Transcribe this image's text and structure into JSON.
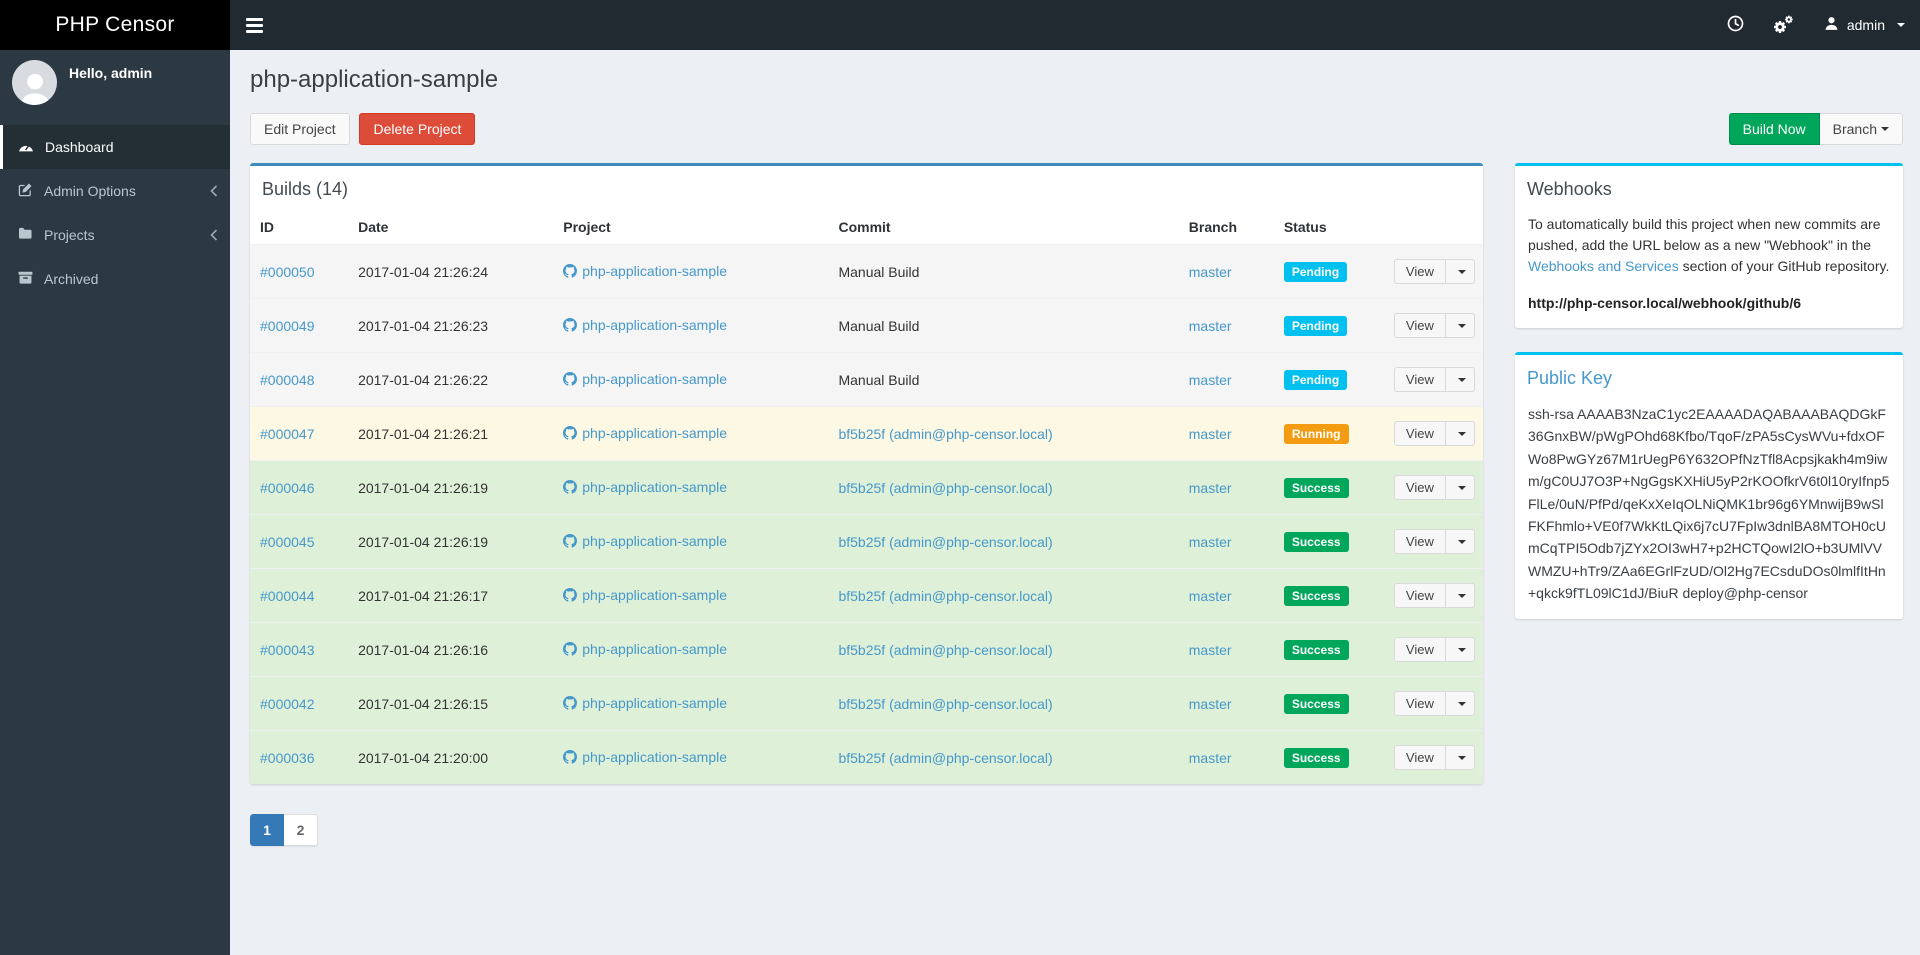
{
  "app": {
    "brand": "PHP Censor"
  },
  "navbar": {
    "user": "admin",
    "icons": [
      "clock-icon",
      "cogs-icon",
      "user-icon",
      "caret-down-icon"
    ]
  },
  "sidebar": {
    "greeting": "Hello, admin",
    "items": [
      {
        "label": "Dashboard",
        "icon": "dashboard-icon",
        "active": true,
        "has_chevron": false
      },
      {
        "label": "Admin Options",
        "icon": "edit-icon",
        "active": false,
        "has_chevron": true
      },
      {
        "label": "Projects",
        "icon": "folder-icon",
        "active": false,
        "has_chevron": true
      },
      {
        "label": "Archived",
        "icon": "archive-icon",
        "active": false,
        "has_chevron": false
      }
    ]
  },
  "page": {
    "title": "php-application-sample",
    "edit_button": "Edit Project",
    "delete_button": "Delete Project",
    "build_now_button": "Build Now",
    "branch_button": "Branch"
  },
  "builds": {
    "panel_title": "Builds (14)",
    "columns": [
      "ID",
      "Date",
      "Project",
      "Commit",
      "Branch",
      "Status"
    ],
    "view_label": "View",
    "rows": [
      {
        "id": "#000050",
        "date": "2017-01-04 21:26:24",
        "project": "php-application-sample",
        "commit": "Manual Build",
        "commit_is_link": false,
        "branch": "master",
        "status": "Pending"
      },
      {
        "id": "#000049",
        "date": "2017-01-04 21:26:23",
        "project": "php-application-sample",
        "commit": "Manual Build",
        "commit_is_link": false,
        "branch": "master",
        "status": "Pending"
      },
      {
        "id": "#000048",
        "date": "2017-01-04 21:26:22",
        "project": "php-application-sample",
        "commit": "Manual Build",
        "commit_is_link": false,
        "branch": "master",
        "status": "Pending"
      },
      {
        "id": "#000047",
        "date": "2017-01-04 21:26:21",
        "project": "php-application-sample",
        "commit": "bf5b25f (admin@php-censor.local)",
        "commit_is_link": true,
        "branch": "master",
        "status": "Running"
      },
      {
        "id": "#000046",
        "date": "2017-01-04 21:26:19",
        "project": "php-application-sample",
        "commit": "bf5b25f (admin@php-censor.local)",
        "commit_is_link": true,
        "branch": "master",
        "status": "Success"
      },
      {
        "id": "#000045",
        "date": "2017-01-04 21:26:19",
        "project": "php-application-sample",
        "commit": "bf5b25f (admin@php-censor.local)",
        "commit_is_link": true,
        "branch": "master",
        "status": "Success"
      },
      {
        "id": "#000044",
        "date": "2017-01-04 21:26:17",
        "project": "php-application-sample",
        "commit": "bf5b25f (admin@php-censor.local)",
        "commit_is_link": true,
        "branch": "master",
        "status": "Success"
      },
      {
        "id": "#000043",
        "date": "2017-01-04 21:26:16",
        "project": "php-application-sample",
        "commit": "bf5b25f (admin@php-censor.local)",
        "commit_is_link": true,
        "branch": "master",
        "status": "Success"
      },
      {
        "id": "#000042",
        "date": "2017-01-04 21:26:15",
        "project": "php-application-sample",
        "commit": "bf5b25f (admin@php-censor.local)",
        "commit_is_link": true,
        "branch": "master",
        "status": "Success"
      },
      {
        "id": "#000036",
        "date": "2017-01-04 21:20:00",
        "project": "php-application-sample",
        "commit": "bf5b25f (admin@php-censor.local)",
        "commit_is_link": true,
        "branch": "master",
        "status": "Success"
      }
    ],
    "pagination": [
      {
        "label": "1",
        "active": true
      },
      {
        "label": "2",
        "active": false
      }
    ]
  },
  "webhooks": {
    "title": "Webhooks",
    "text_before_link": "To automatically build this project when new commits are pushed, add the URL below as a new \"Webhook\" in the ",
    "link_text": "Webhooks and Services",
    "text_after_link": " section of your GitHub repository.",
    "url": "http://php-censor.local/webhook/github/6"
  },
  "public_key": {
    "title": "Public Key",
    "key": "ssh-rsa AAAAB3NzaC1yc2EAAAADAQABAAABAQDGkF36GnxBW/pWgPOhd68Kfbo/TqoF/zPA5sCysWVu+fdxOFWo8PwGYz67M1rUegP6Y632OPfNzTfl8Acpsjkakh4m9iwm/gC0UJ7O3P+NgGgsKXHiU5yP2rKOOfkrV6t0l10ryIfnp5FlLe/0uN/PfPd/qeKxXeIqOLNiQMK1br96g6YMnwijB9wSlFKFhmlo+VE0f7WkKtLQix6j7cU7FpIw3dnlBA8MTOH0cUmCqTPI5Odb7jZYx2OI3wH7+p2HCTQowI2lO+b3UMlVVWMZU+hTr9/ZAa6EGrlFzUD/Ol2Hg7ECsduDOs0lmlfItHn+qkck9fTL09lC1dJ/BiuR deploy@php-censor"
  },
  "colors": {
    "link": "#4698cb",
    "builds_panel_border": "#3c8dbc",
    "info_panel_border": "#00c0ef",
    "status": {
      "pending": "#00c0ef",
      "running": "#f39c12",
      "success": "#00a65a"
    },
    "row_bg": {
      "pending": "#f5f5f5",
      "running": "#fcf8e3",
      "success": "#dff0d8"
    },
    "build_now_bg": "#00a65a",
    "delete_bg": "#dd4b39",
    "pagination_active_bg": "#357ab7",
    "navbar_bg": "#212a31",
    "sidebar_bg": "#2c3943",
    "logo_bg": "#000000"
  }
}
